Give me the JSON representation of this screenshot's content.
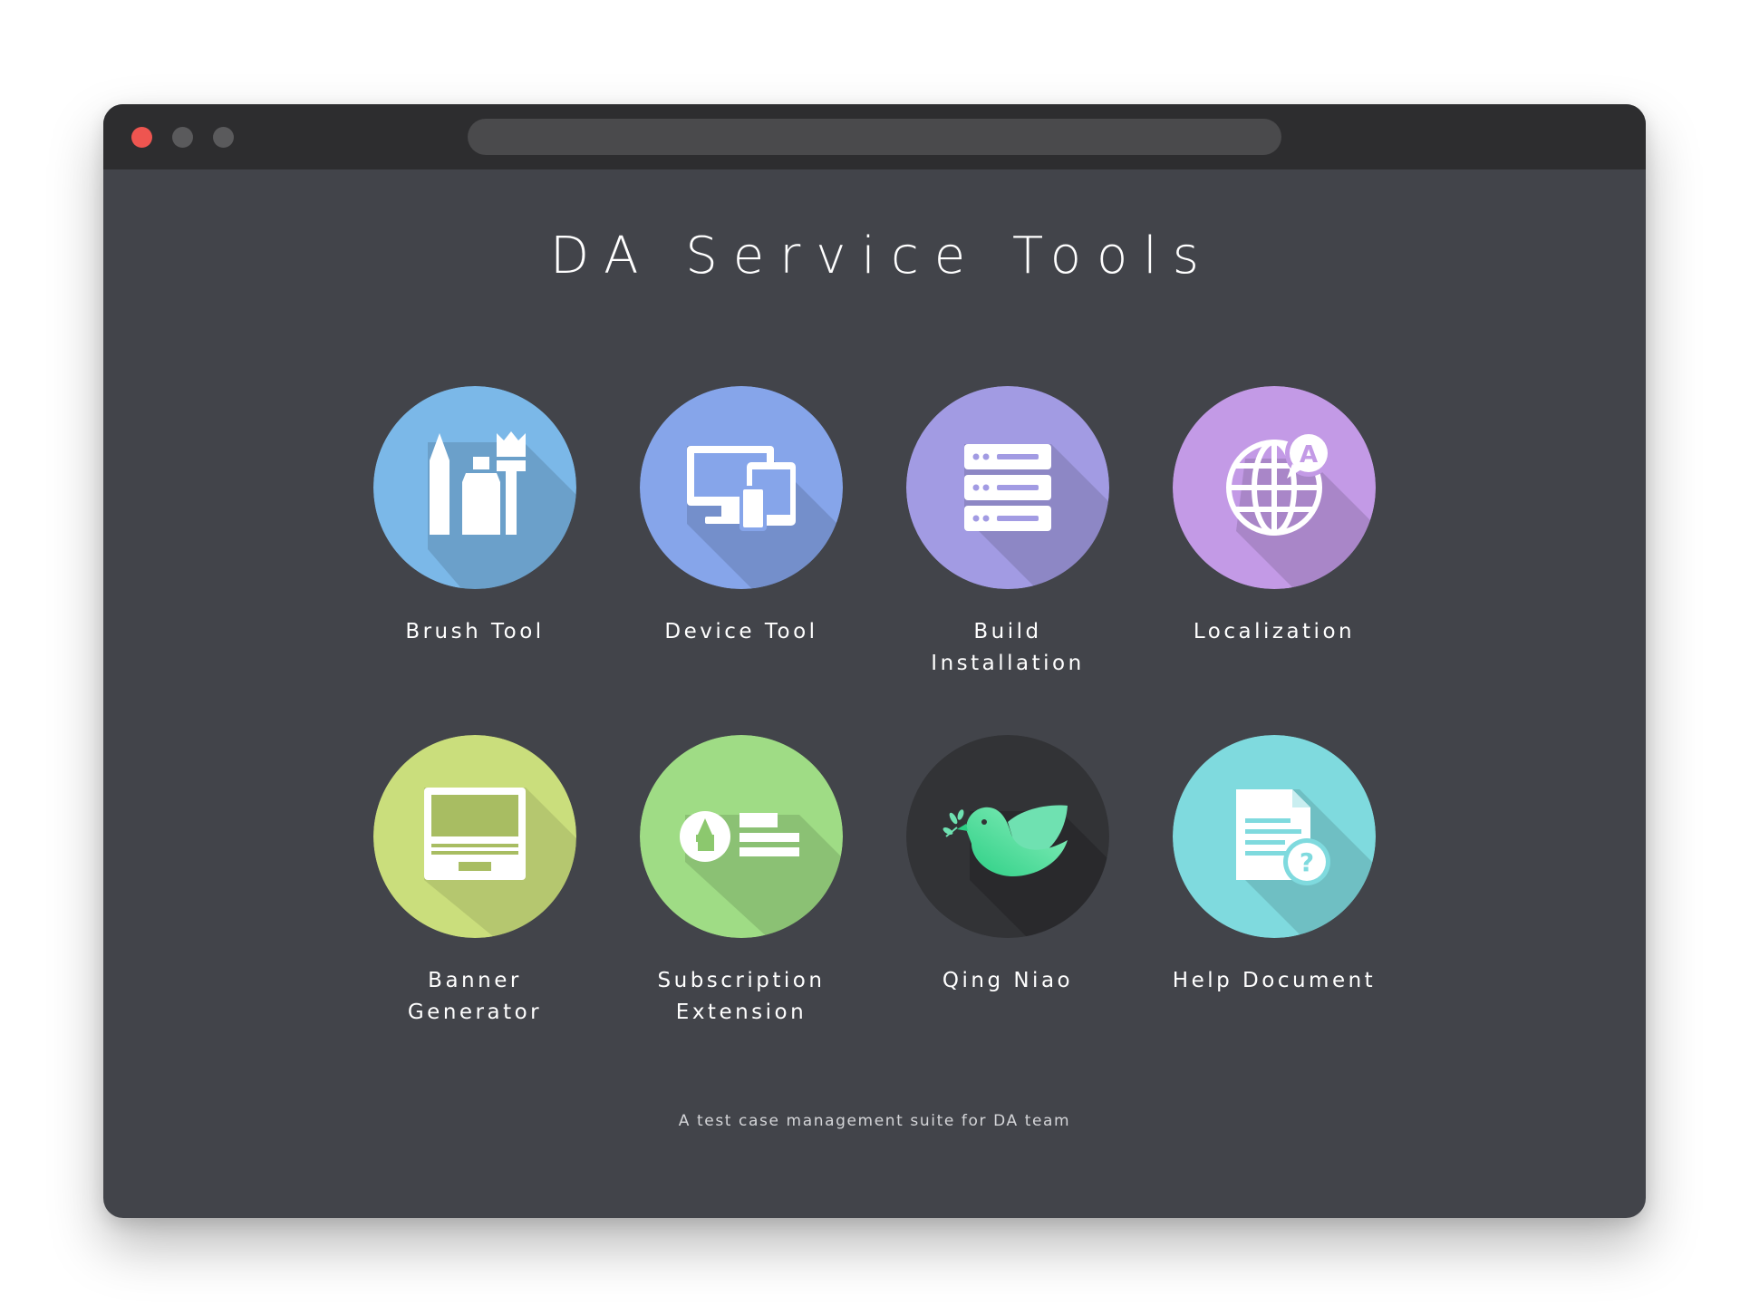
{
  "window": {
    "controls": [
      "close",
      "minimize",
      "maximize"
    ]
  },
  "page": {
    "title": "DA Service Tools",
    "footer": "A test case management suite for DA team"
  },
  "tools": [
    {
      "label": "Brush Tool",
      "icon": "brush-icon",
      "color": "#7bb8e8"
    },
    {
      "label": "Device Tool",
      "icon": "devices-icon",
      "color": "#86a5ea"
    },
    {
      "label": "Build\nInstallation",
      "icon": "server-list-icon",
      "color": "#a29be3"
    },
    {
      "label": "Localization",
      "icon": "globe-translate-icon",
      "color": "#c39ae6"
    },
    {
      "label": "Banner\nGenerator",
      "icon": "banner-icon",
      "color": "#cade7c"
    },
    {
      "label": "Subscription\nExtension",
      "icon": "subscription-icon",
      "color": "#9fdc85"
    },
    {
      "label": "Qing Niao",
      "icon": "bird-icon",
      "color": "#323336"
    },
    {
      "label": "Help Document",
      "icon": "help-document-icon",
      "color": "#7fdade"
    }
  ]
}
